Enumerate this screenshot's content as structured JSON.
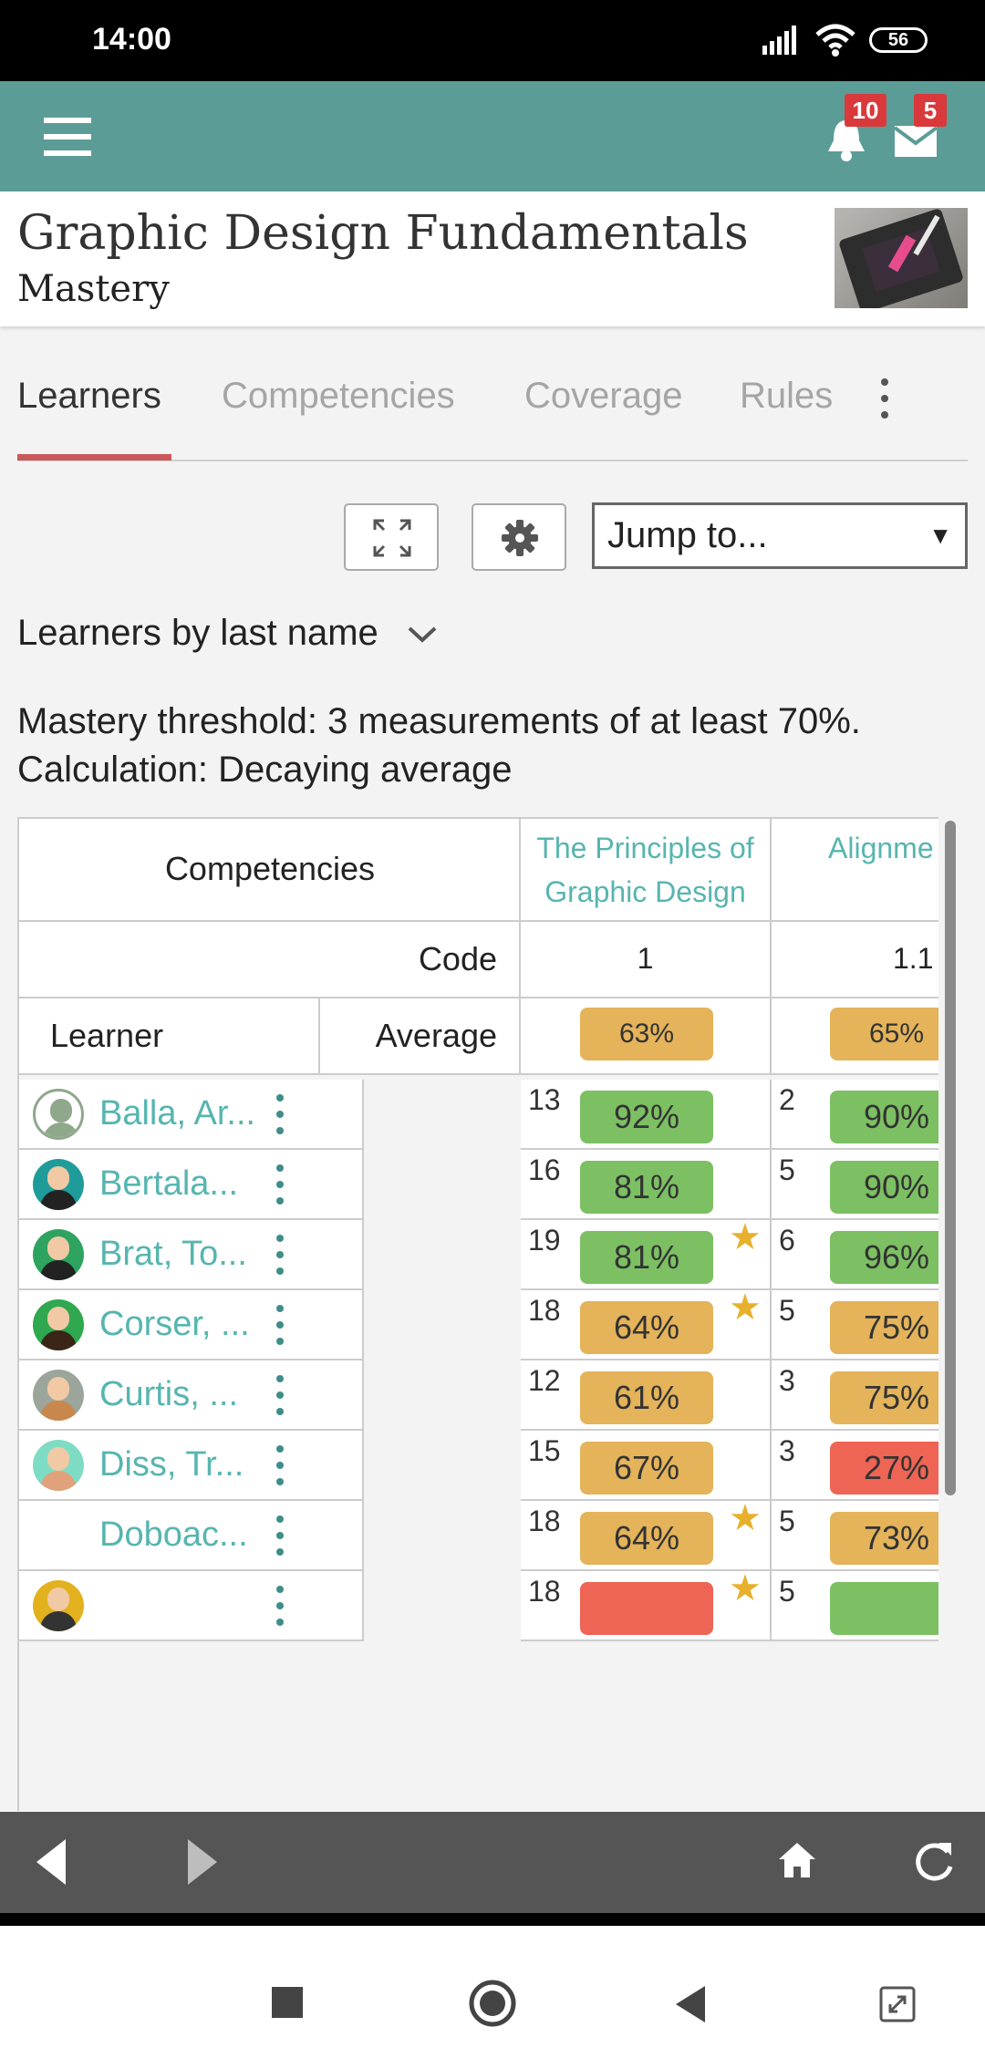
{
  "status_bar": {
    "time": "14:00",
    "battery": "56"
  },
  "app_bar": {
    "notifications_count": "10",
    "messages_count": "5"
  },
  "header": {
    "title": "Graphic Design Fundamentals",
    "subtitle": "Mastery"
  },
  "tabs": [
    {
      "label": "Learners",
      "active": true
    },
    {
      "label": "Competencies",
      "active": false
    },
    {
      "label": "Coverage",
      "active": false
    },
    {
      "label": "Rules",
      "active": false
    }
  ],
  "toolbar": {
    "jump_to": "Jump to..."
  },
  "sort": {
    "label": "Learners by last name"
  },
  "info": {
    "threshold": "Mastery threshold: 3 measurements of at least 70%.",
    "calculation": "Calculation: Decaying average"
  },
  "table": {
    "competencies_label": "Competencies",
    "code_label": "Code",
    "learner_label": "Learner",
    "average_label": "Average",
    "columns": [
      {
        "title": "The Principles of Graphic Design",
        "code": "1",
        "average": "63%",
        "average_status": "orange"
      },
      {
        "title": "Alignme",
        "code": "1.1",
        "average": "65%",
        "average_status": "orange"
      }
    ],
    "rows": [
      {
        "name": "Balla, Ar...",
        "avatar": "default-avatar",
        "c1": {
          "count": "13",
          "value": "92%",
          "status": "green",
          "star": false
        },
        "c2": {
          "count": "2",
          "value": "90%",
          "status": "green"
        }
      },
      {
        "name": "Bertala...",
        "avatar": "avatar-beard-teal",
        "c1": {
          "count": "16",
          "value": "81%",
          "status": "green",
          "star": false
        },
        "c2": {
          "count": "5",
          "value": "90%",
          "status": "green"
        }
      },
      {
        "name": "Brat, To...",
        "avatar": "avatar-beard-green",
        "c1": {
          "count": "19",
          "value": "81%",
          "status": "green",
          "star": true
        },
        "c2": {
          "count": "6",
          "value": "96%",
          "status": "green"
        }
      },
      {
        "name": "Corser, ...",
        "avatar": "avatar-dark-yellow",
        "c1": {
          "count": "18",
          "value": "64%",
          "status": "orange",
          "star": true
        },
        "c2": {
          "count": "5",
          "value": "75%",
          "status": "orange"
        }
      },
      {
        "name": "Curtis, ...",
        "avatar": "avatar-man-grey",
        "c1": {
          "count": "12",
          "value": "61%",
          "status": "orange",
          "star": false
        },
        "c2": {
          "count": "3",
          "value": "75%",
          "status": "orange"
        }
      },
      {
        "name": "Diss, Tr...",
        "avatar": "avatar-man-mint",
        "c1": {
          "count": "15",
          "value": "67%",
          "status": "orange",
          "star": false
        },
        "c2": {
          "count": "3",
          "value": "27%",
          "status": "red"
        }
      },
      {
        "name": "Doboac...",
        "avatar": "none",
        "c1": {
          "count": "18",
          "value": "64%",
          "status": "orange",
          "star": true
        },
        "c2": {
          "count": "5",
          "value": "73%",
          "status": "orange"
        }
      },
      {
        "name": "",
        "avatar": "avatar-yellow",
        "c1": {
          "count": "18",
          "value": "",
          "status": "red",
          "star": true
        },
        "c2": {
          "count": "5",
          "value": "",
          "status": "green"
        }
      }
    ]
  },
  "colors": {
    "teal_header": "#5b9c96",
    "link": "#57b5b0",
    "green": "#7cc063",
    "orange": "#e4b35a",
    "red": "#ee6455",
    "active_tab": "#c9595a"
  }
}
